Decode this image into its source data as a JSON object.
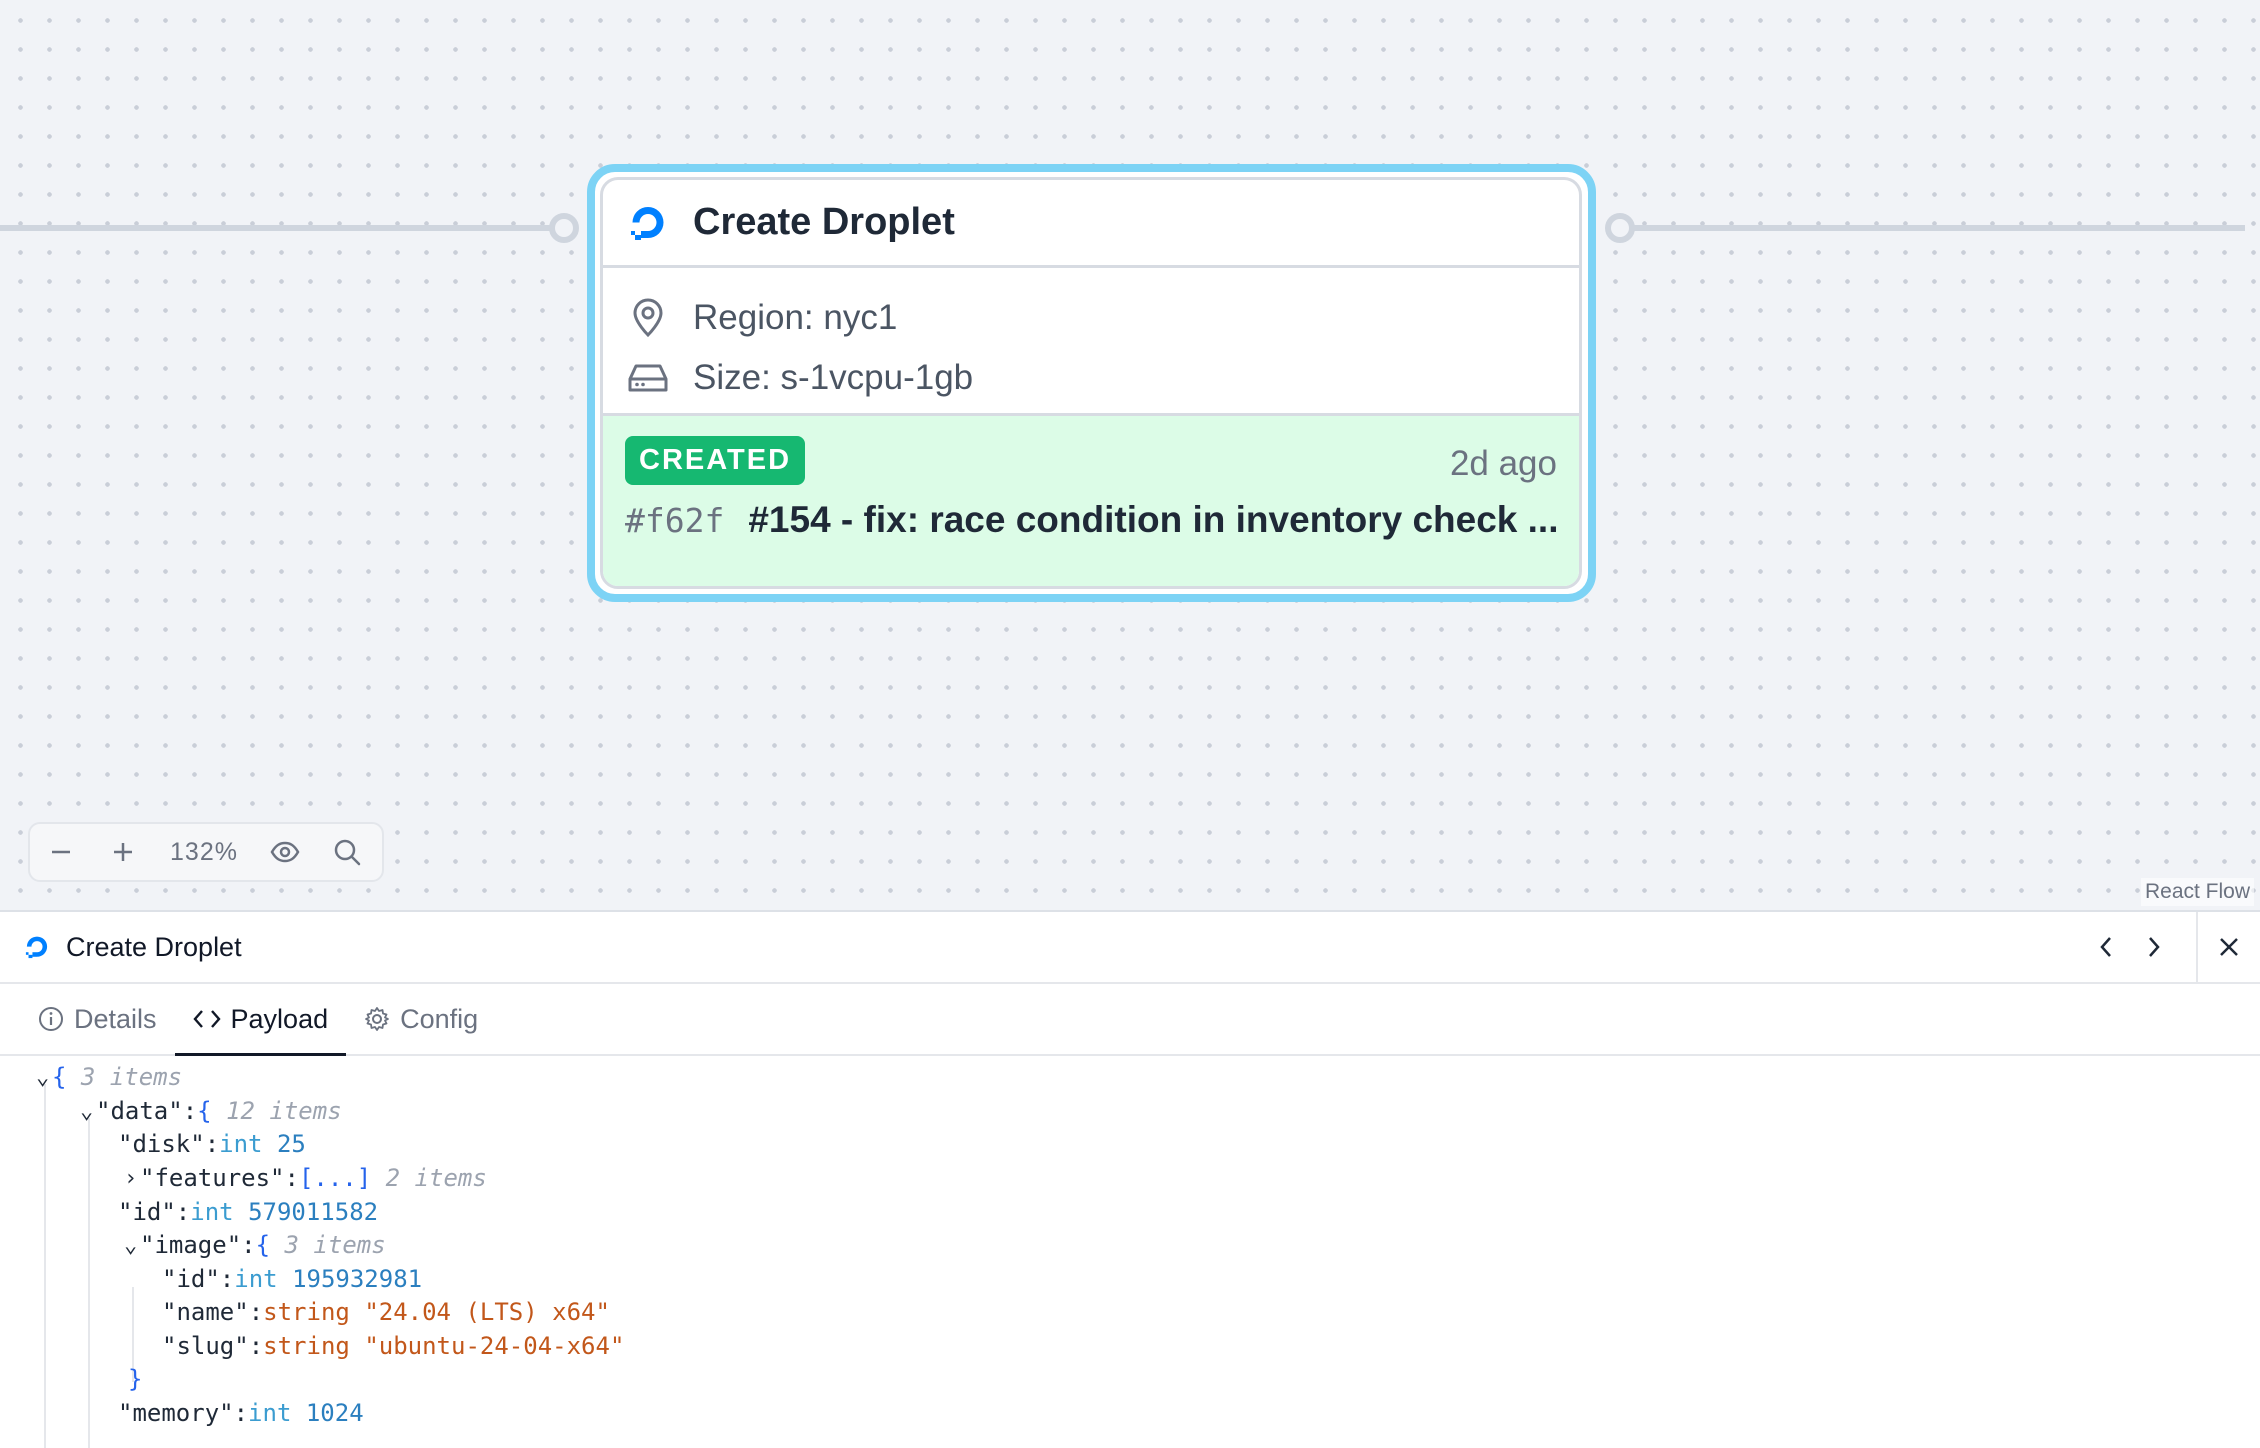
{
  "canvas": {
    "node": {
      "title": "Create Droplet",
      "region": "Region: nyc1",
      "size": "Size: s-1vcpu-1gb",
      "status_badge": "CREATED",
      "status_time": "2d ago",
      "commit_hash": "#f62f",
      "commit_message": "#154 - fix: race condition in inventory check ..."
    },
    "controls": {
      "zoom_level": "132%",
      "zoom_out_icon": "minus-icon",
      "zoom_in_icon": "plus-icon",
      "view_icon": "eye-icon",
      "search_icon": "search-icon"
    },
    "attribution": "React Flow"
  },
  "panel": {
    "title": "Create Droplet",
    "tabs": [
      {
        "label": "Details",
        "icon": "info-icon",
        "active": false
      },
      {
        "label": "Payload",
        "icon": "code-icon",
        "active": true
      },
      {
        "label": "Config",
        "icon": "gear-icon",
        "active": false
      }
    ],
    "json": {
      "root_brace": "{",
      "root_count": "3 items",
      "data_key": "\"data\"",
      "data_count": "12 items",
      "disk_key": "\"disk\"",
      "disk_type": "int",
      "disk_value": "25",
      "features_key": "\"features\"",
      "features_value": "[...]",
      "features_count": "2 items",
      "id_key": "\"id\"",
      "id_type": "int",
      "id_value": "579011582",
      "image_key": "\"image\"",
      "image_count": "3 items",
      "image_id_key": "\"id\"",
      "image_id_type": "int",
      "image_id_value": "195932981",
      "image_name_key": "\"name\"",
      "image_name_type": "string",
      "image_name_value": "\"24.04 (LTS) x64\"",
      "image_slug_key": "\"slug\"",
      "image_slug_type": "string",
      "image_slug_value": "\"ubuntu-24-04-x64\"",
      "image_close": "}",
      "memory_key": "\"memory\"",
      "memory_type": "int",
      "memory_value": "1024"
    }
  },
  "colors": {
    "node_outline": "#7dd3f5",
    "status_bg": "#dcfce7",
    "badge_bg": "#16b871",
    "brand_blue": "#0080ff"
  }
}
